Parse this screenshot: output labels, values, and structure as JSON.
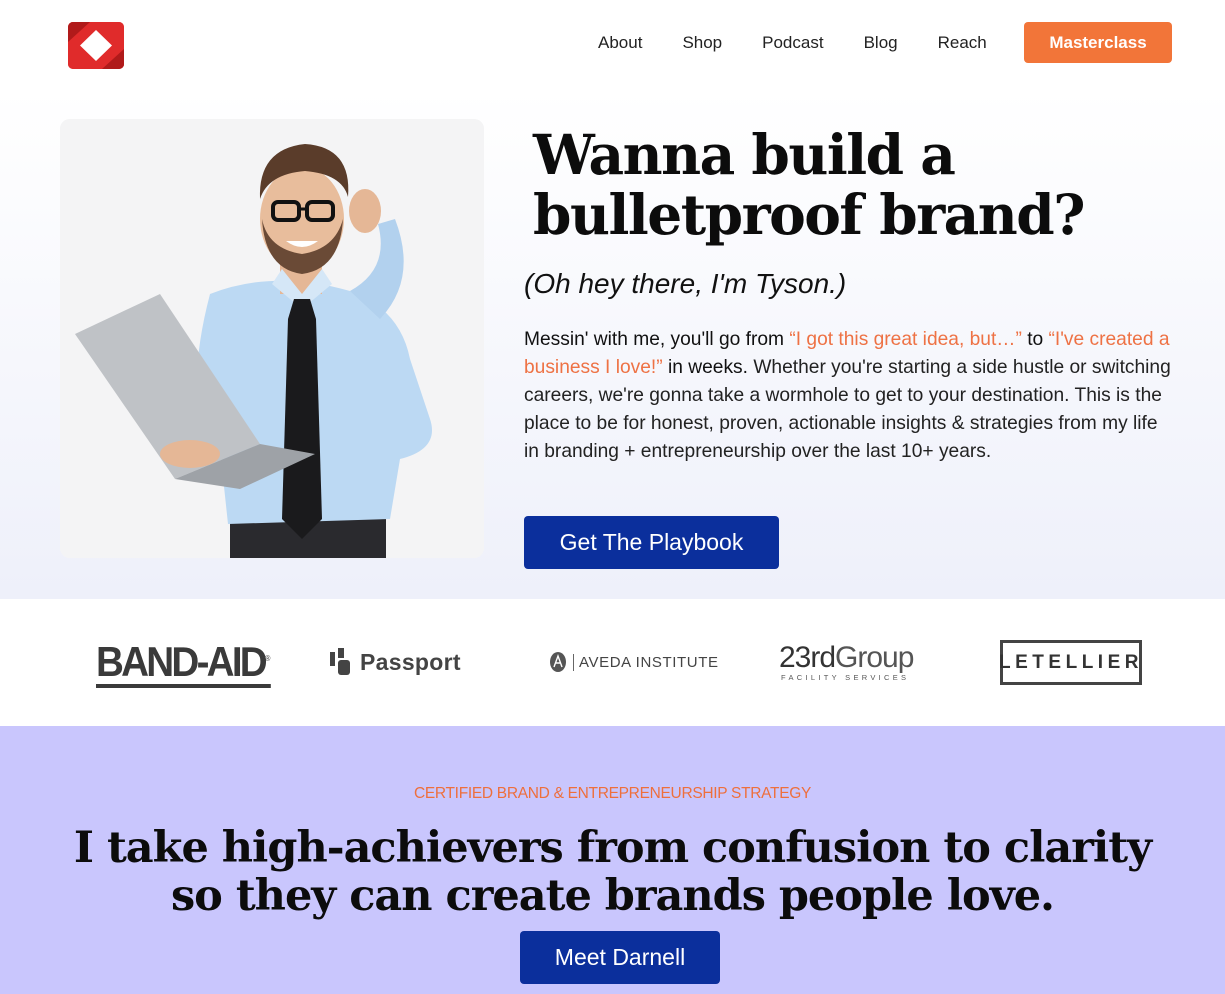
{
  "header": {
    "nav": [
      {
        "label": "About"
      },
      {
        "label": "Shop"
      },
      {
        "label": "Podcast"
      },
      {
        "label": "Blog"
      },
      {
        "label": "Reach"
      }
    ],
    "cta_label": "Masterclass"
  },
  "hero": {
    "title": "Wanna build a bulletproof brand?",
    "subtitle": "(Oh hey there, I'm Tyson.)",
    "body": {
      "intro": "Messin' with me, you'll go from ",
      "quote1": "“I got this great idea, but…”",
      "to": " to ",
      "quote2": "“I've created a business I love!”",
      "in_weeks": " in weeks.",
      "rest": " Whether you're starting a side hustle or switching careers, we're gonna take a wormhole to get to your destination. This is the place to be for honest, proven, actionable insights & strategies from my life in branding + entrepreneurship over the last 10+ years."
    },
    "cta_label": "Get The Playbook"
  },
  "brands": {
    "bandaid": "BAND-AID",
    "bandaid_mark": "®",
    "passport": "Passport",
    "aveda": "AVEDA INSTITUTE",
    "group23_bold": "23rd",
    "group23_light": "Group",
    "group23_sub": "FACILITY SERVICES",
    "letellier": "LETELLIER"
  },
  "strategy": {
    "eyebrow": "CERTIFIED BRAND & ENTREPRENEURSHIP STRATEGY",
    "title": "I take high-achievers from confusion to clarity so they can create brands people love.",
    "cta_label": "Meet Darnell"
  },
  "colors": {
    "accent_orange": "#f27539",
    "primary_blue": "#0b2f9c",
    "lavender": "#c9c6fd",
    "logo_red": "#e02b2b"
  }
}
